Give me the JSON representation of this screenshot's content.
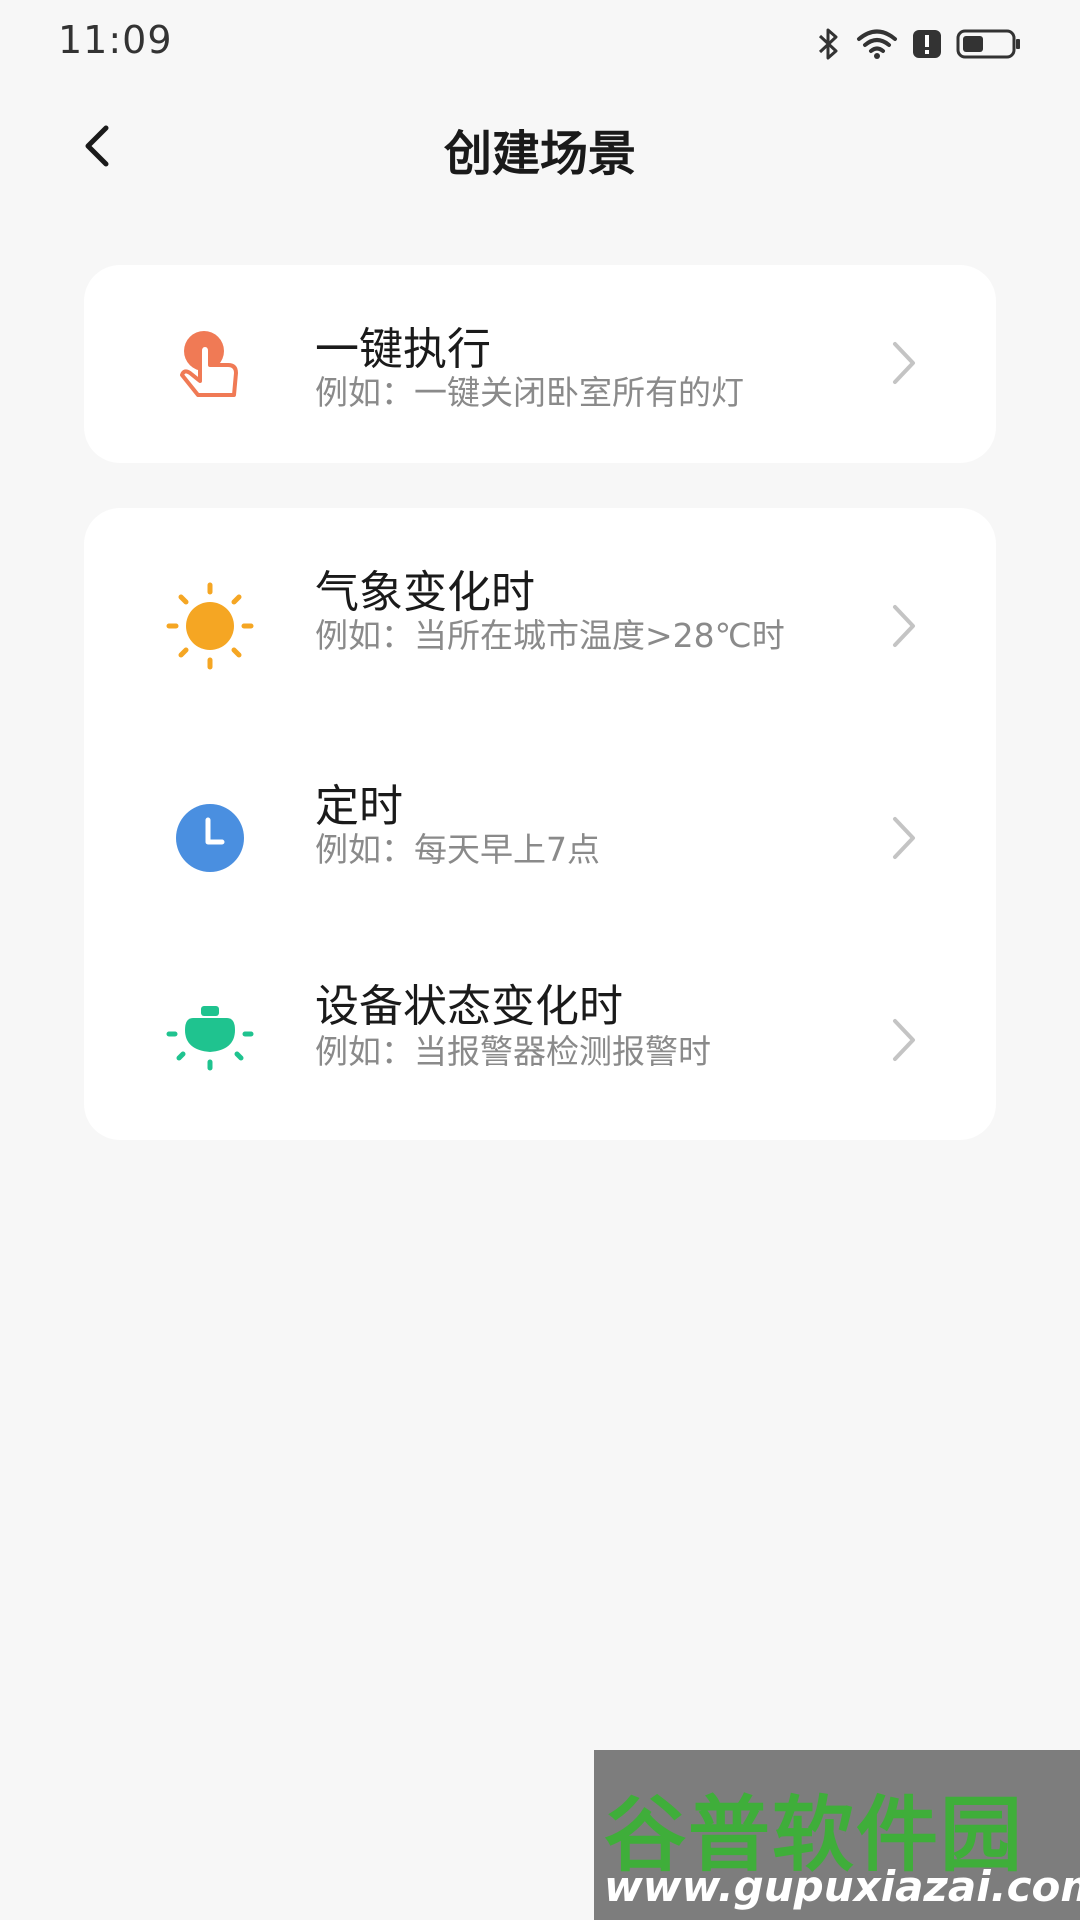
{
  "status_bar": {
    "time": "11:09"
  },
  "header": {
    "title": "创建场景"
  },
  "items": [
    {
      "title": "一键执行",
      "desc": "例如：一键关闭卧室所有的灯",
      "icon": "tap-hand-icon",
      "color": "#f07a55"
    },
    {
      "title": "气象变化时",
      "desc": "例如：当所在城市温度>28℃时",
      "icon": "sun-icon",
      "color": "#f5a623"
    },
    {
      "title": "定时",
      "desc": "例如：每天早上7点",
      "icon": "clock-icon",
      "color": "#4a8fe0"
    },
    {
      "title": "设备状态变化时",
      "desc": "例如：当报警器检测报警时",
      "icon": "bulb-icon",
      "color": "#1fc38f"
    }
  ],
  "watermark": {
    "name": "谷普软件园",
    "url": "www.gupuxiazai.com"
  }
}
